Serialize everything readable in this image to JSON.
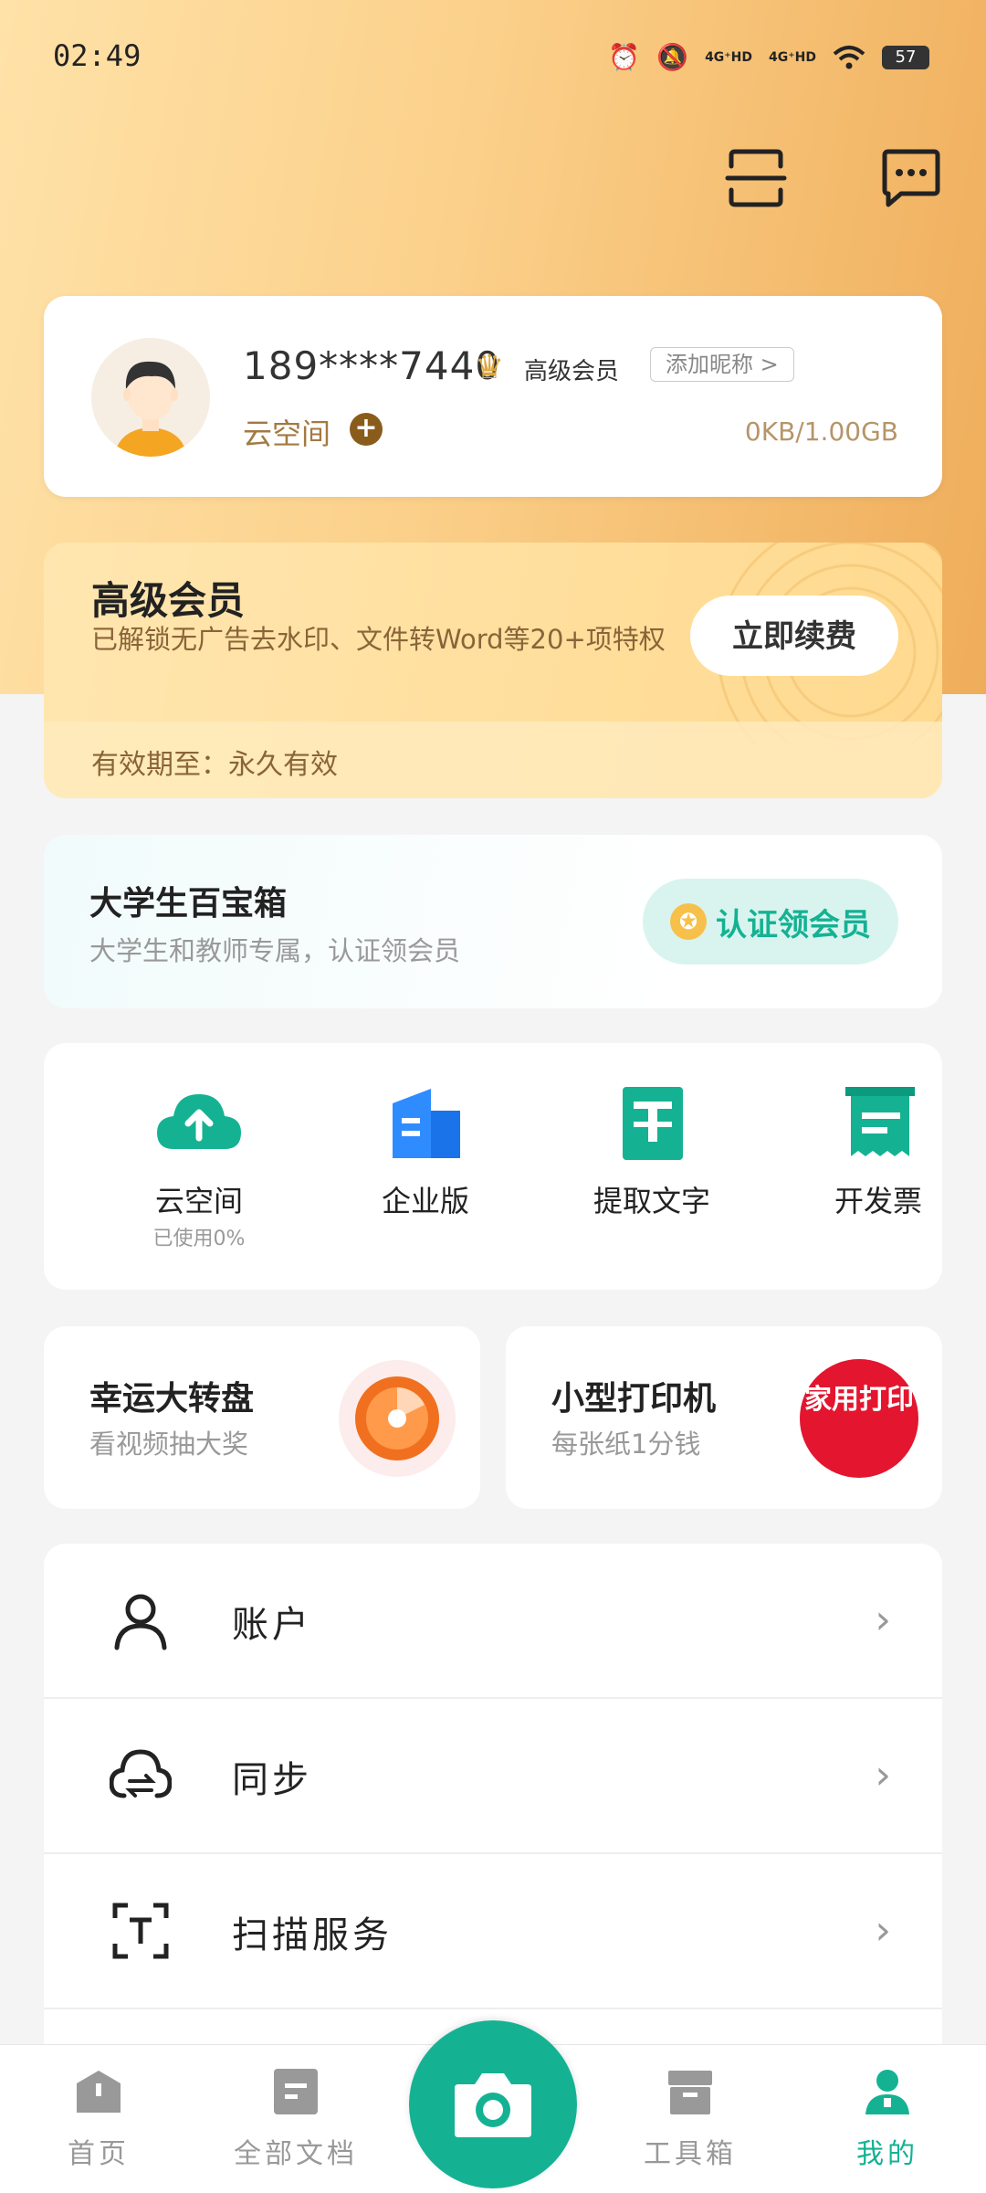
{
  "status_bar": {
    "time": "02:49",
    "signal_1": "4G⁺HD",
    "signal_2": "4G⁺HD",
    "battery": "57"
  },
  "profile": {
    "phone": "189****7440",
    "member_label": "高级会员",
    "add_nickname": "添加昵称 >",
    "cloud_label": "云空间",
    "storage": "0KB/1.00GB"
  },
  "vip": {
    "title": "高级会员",
    "description": "已解锁无广告去水印、文件转Word等20+项特权",
    "renew_button": "立即续费",
    "expiry": "有效期至：永久有效"
  },
  "student": {
    "title": "大学生百宝箱",
    "description": "大学生和教师专属，认证领会员",
    "verify_button": "认证领会员"
  },
  "tools": [
    {
      "label": "云空间",
      "sub": "已使用0%"
    },
    {
      "label": "企业版"
    },
    {
      "label": "提取文字"
    },
    {
      "label": "开发票"
    }
  ],
  "promos": [
    {
      "title": "幸运大转盘",
      "description": "看视频抽大奖"
    },
    {
      "title": "小型打印机",
      "description": "每张纸1分钱",
      "badge": "家用打印"
    }
  ],
  "menu": [
    {
      "label": "账户"
    },
    {
      "label": "同步"
    },
    {
      "label": "扫描服务"
    }
  ],
  "nav": [
    {
      "label": "首页"
    },
    {
      "label": "全部文档"
    },
    {
      "label": "工具箱"
    },
    {
      "label": "我的"
    }
  ],
  "colors": {
    "accent": "#14b293",
    "gold": "#e0a73b"
  }
}
